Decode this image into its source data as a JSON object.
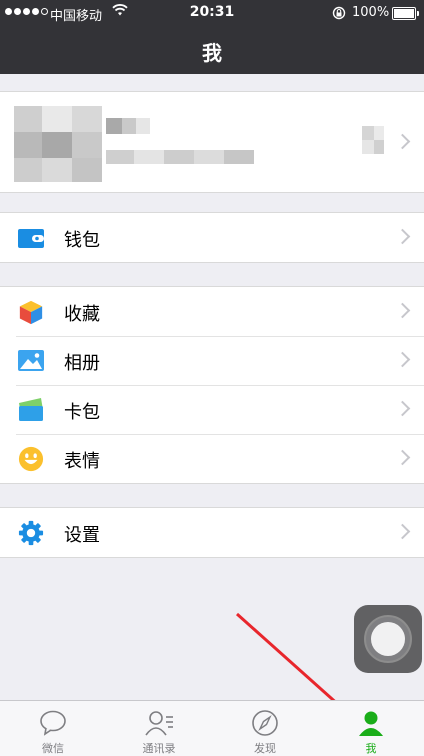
{
  "status_bar": {
    "carrier": "中国移动",
    "time": "20:31",
    "battery": "100%"
  },
  "header": {
    "title": "我"
  },
  "menu": {
    "wallet": "钱包",
    "favorites": "收藏",
    "album": "相册",
    "cards": "卡包",
    "stickers": "表情",
    "settings": "设置"
  },
  "tabbar": {
    "tabs": [
      {
        "label": "微信",
        "icon": "chat-icon"
      },
      {
        "label": "通讯录",
        "icon": "contacts-icon"
      },
      {
        "label": "发现",
        "icon": "compass-icon"
      },
      {
        "label": "我",
        "icon": "me-icon",
        "active": true
      }
    ]
  },
  "colors": {
    "header": "#333337",
    "accent": "#1aad19",
    "icon_blue": "#1a8de2",
    "background": "#eeeef3"
  }
}
